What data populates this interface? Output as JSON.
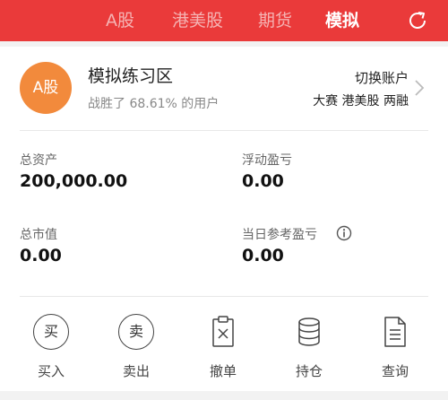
{
  "tabs": [
    {
      "label": "A股",
      "active": false
    },
    {
      "label": "港美股",
      "active": false
    },
    {
      "label": "期货",
      "active": false
    },
    {
      "label": "模拟",
      "active": true
    }
  ],
  "account": {
    "avatar_text": "A股",
    "title": "模拟练习区",
    "subtitle": "战胜了 68.61% 的用户",
    "switch_label": "切换账户",
    "switch_options": "大赛 港美股 两融"
  },
  "stats": [
    {
      "label": "总资产",
      "value": "200,000.00"
    },
    {
      "label": "浮动盈亏",
      "value": "0.00"
    },
    {
      "label": "总市值",
      "value": "0.00"
    },
    {
      "label": "当日参考盈亏",
      "value": "0.00"
    }
  ],
  "actions": [
    {
      "label": "买入",
      "glyph": "买",
      "icon": "buy-icon"
    },
    {
      "label": "卖出",
      "glyph": "卖",
      "icon": "sell-icon"
    },
    {
      "label": "撤单",
      "icon": "cancel-order-icon"
    },
    {
      "label": "持仓",
      "icon": "holdings-icon"
    },
    {
      "label": "查询",
      "icon": "query-icon"
    }
  ],
  "colors": {
    "brand_red": "#ea3a3a",
    "avatar_orange": "#f28a3c",
    "inactive_tab": "#f5b3b3"
  }
}
